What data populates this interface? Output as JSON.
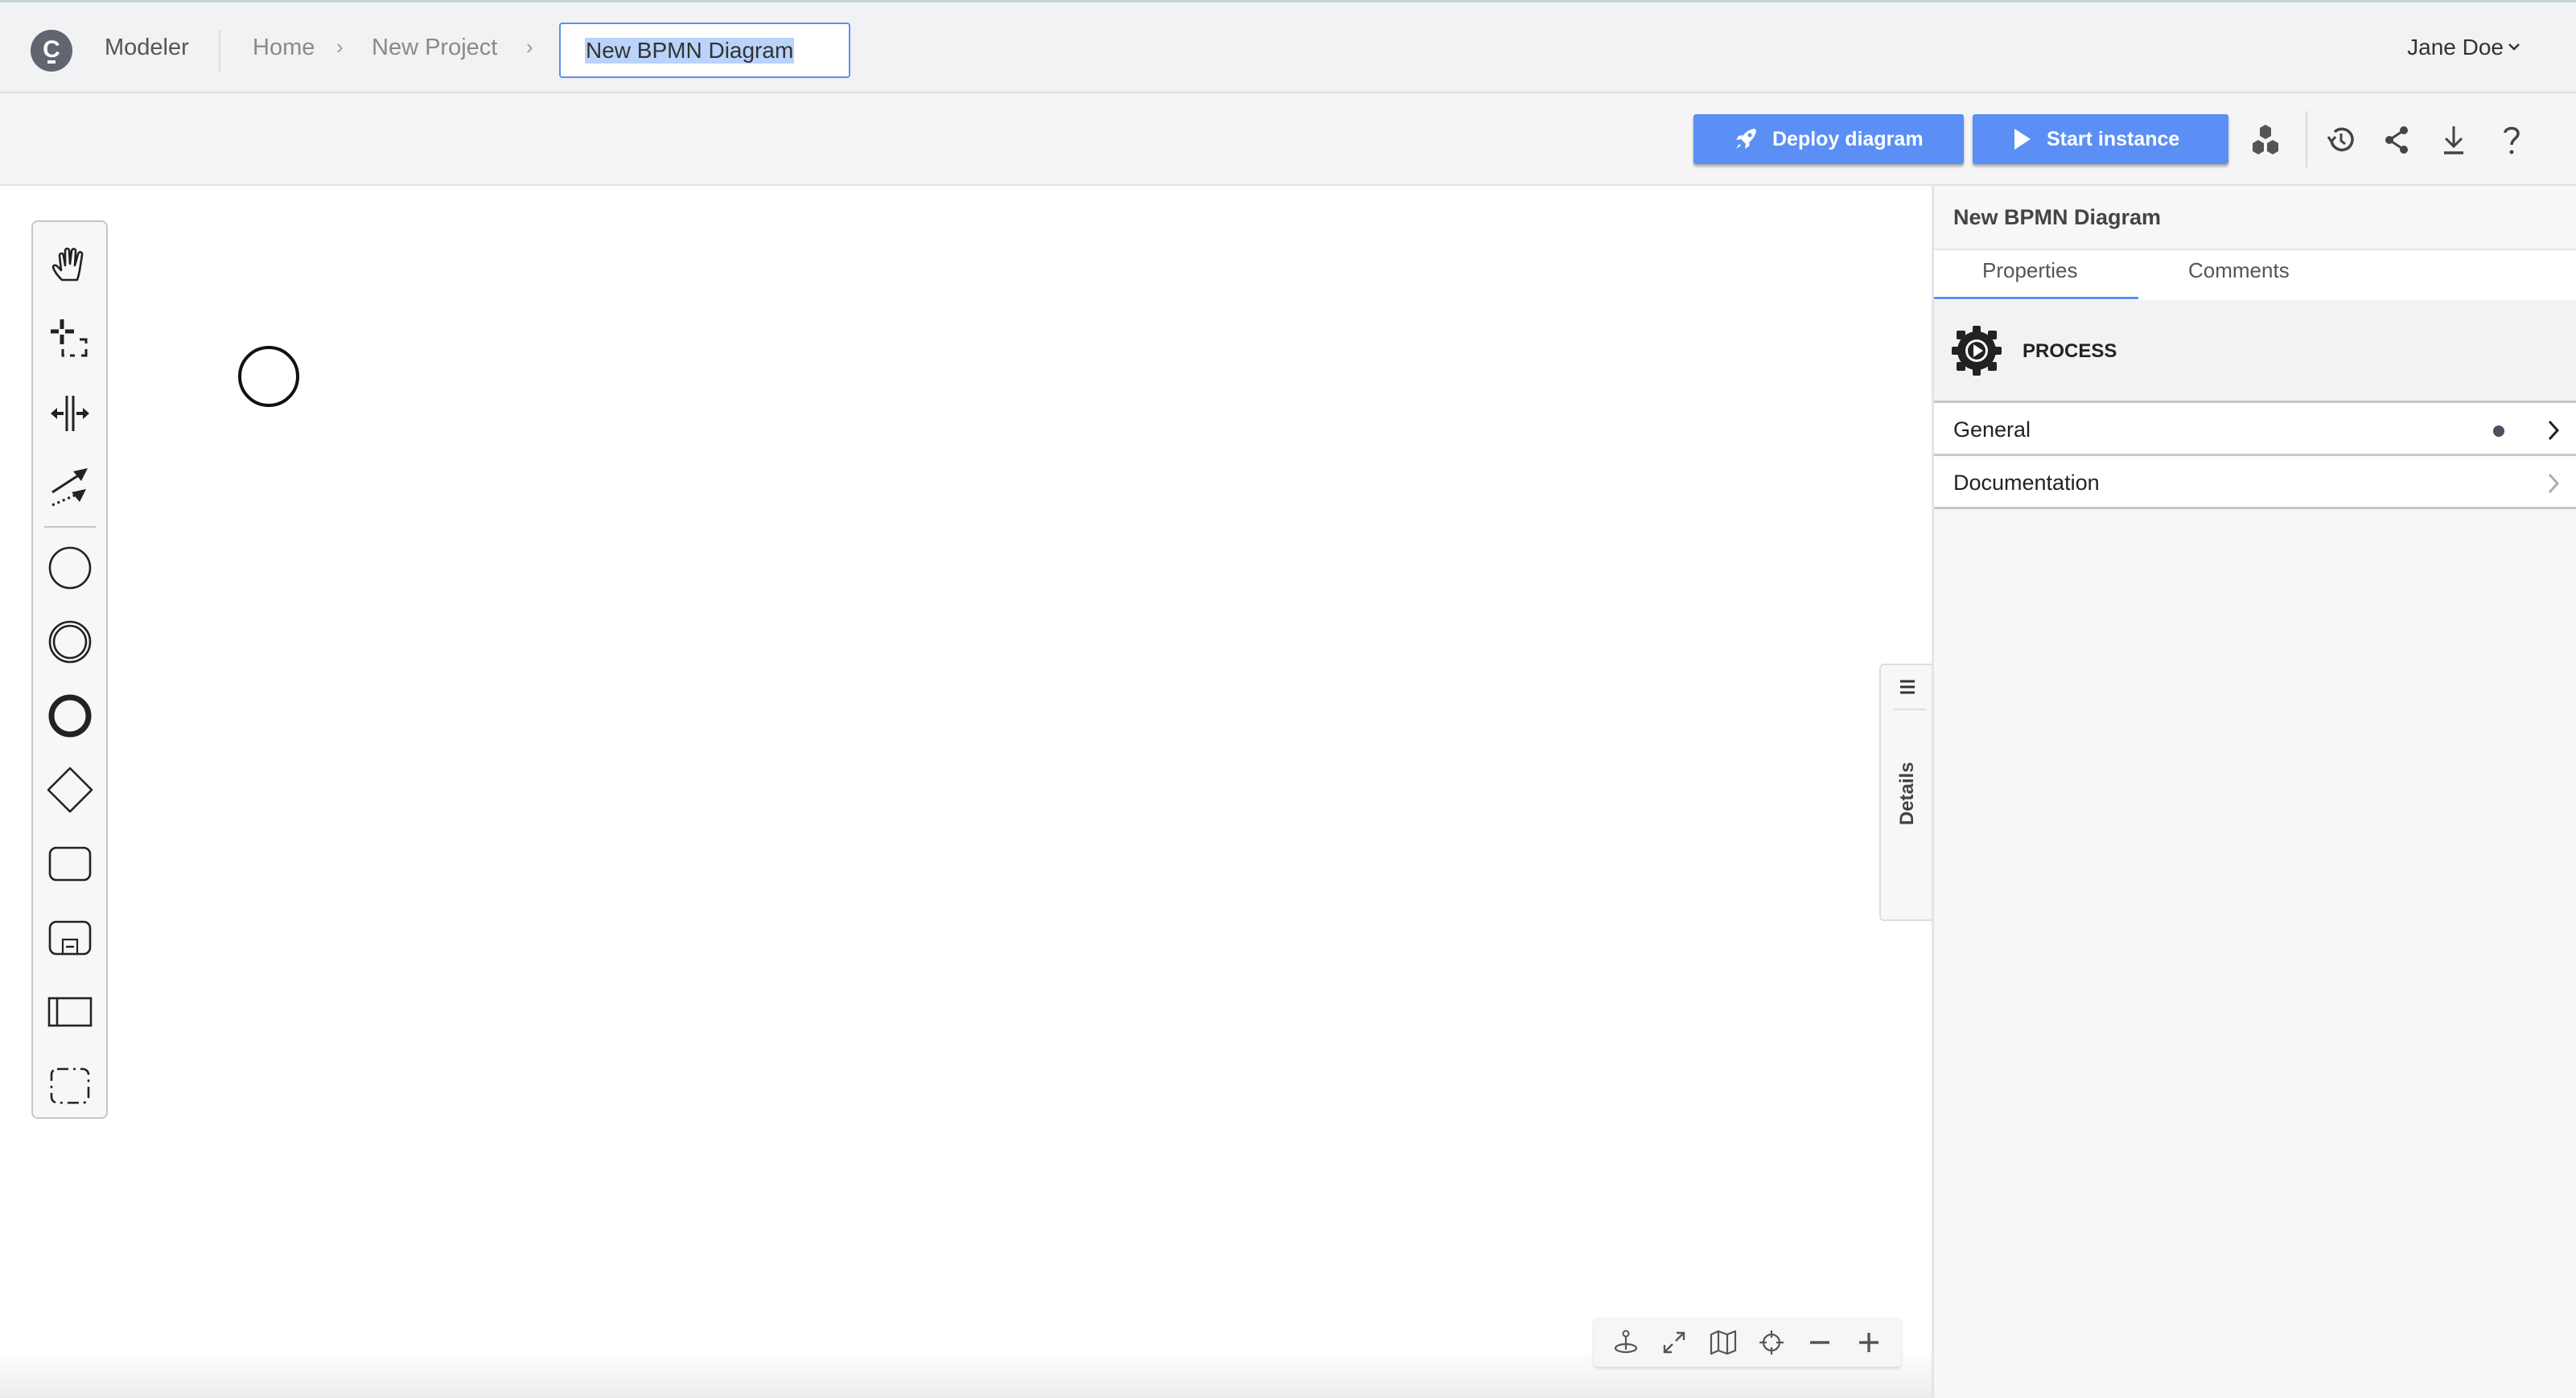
{
  "header": {
    "logo_letter": "C",
    "app_name": "Modeler",
    "breadcrumbs": [
      {
        "label": "Home"
      },
      {
        "label": "New Project"
      }
    ],
    "breadcrumb_separator": "›",
    "diagram_name_value": "New BPMN Diagram",
    "user_name": "Jane Doe"
  },
  "toolbar": {
    "deploy_label": "Deploy diagram",
    "start_label": "Start instance",
    "icons": [
      "hexagons-icon",
      "history-icon",
      "share-icon",
      "download-icon",
      "help-icon"
    ],
    "accent_color": "#5b8ff5"
  },
  "palette": {
    "tools": [
      "hand-tool",
      "lasso-tool",
      "space-tool",
      "global-connect-tool"
    ],
    "elements": [
      "start-event",
      "intermediate-event",
      "end-event",
      "gateway",
      "task",
      "subprocess",
      "pool-participant",
      "group"
    ]
  },
  "canvas": {
    "elements": [
      {
        "type": "start-event"
      }
    ]
  },
  "details_tab": {
    "label": "Details"
  },
  "zoom_controls": [
    "reset-view-icon",
    "fit-viewport-icon",
    "minimap-icon",
    "center-icon",
    "zoom-out-icon",
    "zoom-in-icon"
  ],
  "properties_panel": {
    "title": "New BPMN Diagram",
    "tabs": [
      {
        "label": "Properties",
        "active": true
      },
      {
        "label": "Comments",
        "active": false
      }
    ],
    "element_type": "PROCESS",
    "groups": [
      {
        "label": "General",
        "has_dot": true
      },
      {
        "label": "Documentation",
        "has_dot": false
      }
    ]
  }
}
